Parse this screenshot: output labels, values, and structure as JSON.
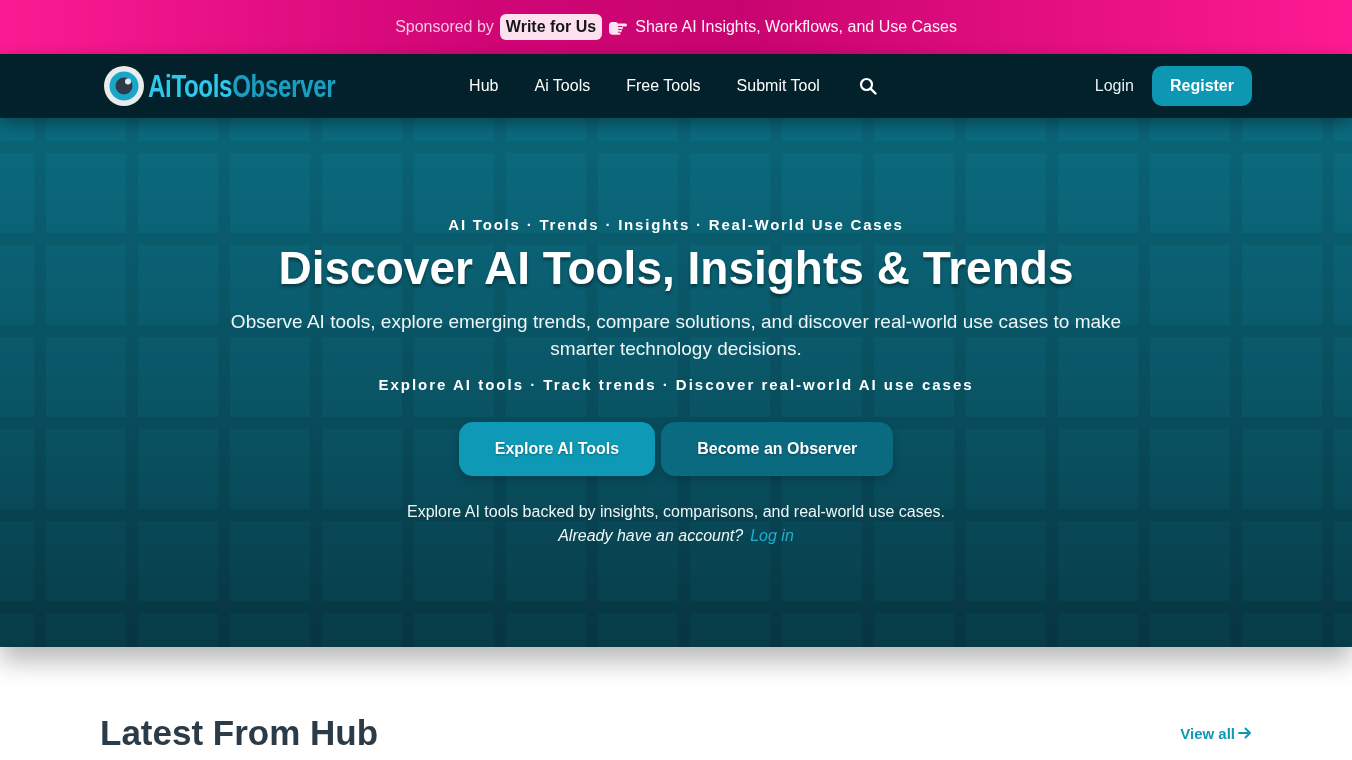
{
  "sponsor_bar": {
    "lead": "Sponsored by",
    "badge": "Write for Us",
    "message": "Share AI Insights, Workflows, and Use Cases"
  },
  "nav": {
    "logo": {
      "prefix": "AiTools",
      "suffix": "Observer"
    },
    "links": [
      {
        "label": "Hub"
      },
      {
        "label": "Ai Tools"
      },
      {
        "label": "Free Tools"
      },
      {
        "label": "Submit Tool"
      }
    ],
    "login": "Login",
    "register": "Register"
  },
  "hero": {
    "eyebrow": "AI Tools · Trends · Insights · Real-World Use Cases",
    "title": "Discover AI Tools, Insights & Trends",
    "lead": "Observe AI tools, explore emerging trends, compare solutions, and discover real-world use cases to make smarter technology decisions.",
    "highlights": "Explore AI tools · Track trends · Discover real-world AI use cases",
    "buttons": [
      {
        "label": "Explore AI Tools",
        "kind": "primary"
      },
      {
        "label": "Become an Observer",
        "kind": "secondary"
      }
    ],
    "note": "Explore AI tools backed by insights, comparisons, and real-world use cases.",
    "login_prompt": {
      "text": "Already have an account?",
      "link": "Log in"
    }
  },
  "section": {
    "title": "Latest From Hub",
    "link": "View all"
  }
}
